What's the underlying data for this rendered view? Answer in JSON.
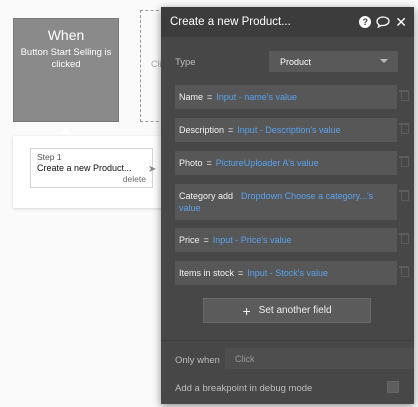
{
  "event": {
    "title": "When",
    "description": "Button Start Selling is clicked"
  },
  "placeholder": {
    "text": "Cli"
  },
  "step": {
    "number": "Step 1",
    "name": "Create a new Product...",
    "delete_label": "delete"
  },
  "panel": {
    "title": "Create a new Product...",
    "icons": [
      "help-icon",
      "comment-icon",
      "close-icon"
    ],
    "type_label": "Type",
    "type_value": "Product",
    "fields": [
      {
        "label": "Name",
        "eq": "=",
        "value": "Input - name's value"
      },
      {
        "label": "Description",
        "eq": "=",
        "value": "Input - Description's value"
      },
      {
        "label": "Photo",
        "eq": "=",
        "value": "PictureUploader A's value"
      },
      {
        "label": "Category add",
        "eq": "",
        "value": "Dropdown Choose a category...'s value"
      },
      {
        "label": "Price",
        "eq": "=",
        "value": "Input - Price's value"
      },
      {
        "label": "Items in stock",
        "eq": "=",
        "value": "Input - Stock's value"
      }
    ],
    "set_field_label": "Set another field",
    "only_when_label": "Only when",
    "only_when_placeholder": "Click",
    "breakpoint_label": "Add a breakpoint in debug mode"
  },
  "colors": {
    "panel_bg": "#474747",
    "field_bg": "#575757",
    "value_text": "#5aa3ee",
    "event_card": "#8a8a8a"
  }
}
